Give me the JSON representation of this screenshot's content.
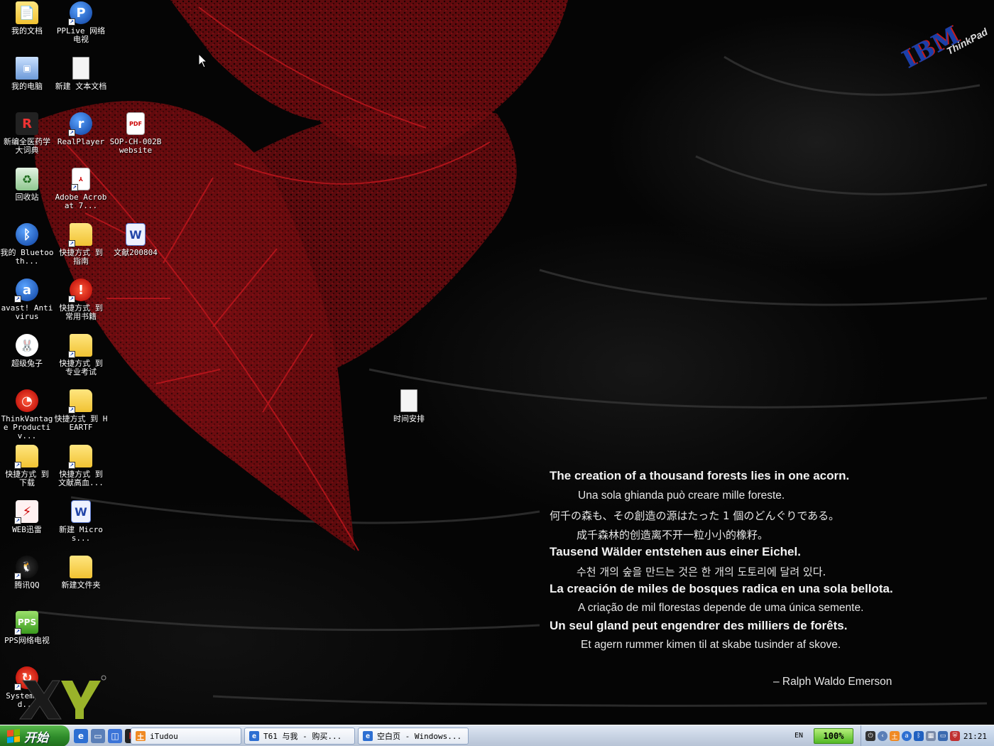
{
  "desktop": {
    "icons": [
      {
        "label": "我的文档",
        "icon": "my-documents-icon",
        "shortcut": false
      },
      {
        "label": "PPLive 网络电视",
        "icon": "pplive-icon",
        "shortcut": true
      },
      {
        "label": "我的电脑",
        "icon": "my-computer-icon",
        "shortcut": false
      },
      {
        "label": "新建 文本文档",
        "icon": "text-document-icon",
        "shortcut": false
      },
      {
        "label": "新编全医药学大词典",
        "icon": "dictionary-app-icon",
        "shortcut": false
      },
      {
        "label": "RealPlayer",
        "icon": "realplayer-icon",
        "shortcut": true
      },
      {
        "label": "SOP-CH-002B website",
        "icon": "pdf-file-icon",
        "shortcut": false
      },
      {
        "label": "回收站",
        "icon": "recycle-bin-icon",
        "shortcut": false
      },
      {
        "label": "Adobe Acrobat 7...",
        "icon": "adobe-acrobat-icon",
        "shortcut": true
      },
      {
        "label": "我的 Bluetooth...",
        "icon": "bluetooth-icon",
        "shortcut": false
      },
      {
        "label": "快捷方式 到 指南",
        "icon": "folder-icon",
        "shortcut": true
      },
      {
        "label": "文献200804",
        "icon": "word-document-icon",
        "shortcut": false
      },
      {
        "label": "avast! Antivirus",
        "icon": "avast-icon",
        "shortcut": true
      },
      {
        "label": "快捷方式 到 常用书籍",
        "icon": "book-app-icon",
        "shortcut": true
      },
      {
        "label": "超级兔子",
        "icon": "rabbit-app-icon",
        "shortcut": false
      },
      {
        "label": "快捷方式 到 专业考试",
        "icon": "folder-icon",
        "shortcut": true
      },
      {
        "label": "ThinkVantage Productiv...",
        "icon": "thinkvantage-icon",
        "shortcut": false
      },
      {
        "label": "快捷方式 到 HEARTF",
        "icon": "folder-icon",
        "shortcut": true
      },
      {
        "label": "时间安排",
        "icon": "text-document-icon",
        "shortcut": false
      },
      {
        "label": "快捷方式 到 下载",
        "icon": "folder-icon",
        "shortcut": true
      },
      {
        "label": "快捷方式 到 文献高血...",
        "icon": "folder-icon",
        "shortcut": true
      },
      {
        "label": "WEB迅雷",
        "icon": "web-thunder-icon",
        "shortcut": true
      },
      {
        "label": "新建 Micros...",
        "icon": "word-document-icon",
        "shortcut": false
      },
      {
        "label": "腾讯QQ",
        "icon": "qq-penguin-icon",
        "shortcut": true
      },
      {
        "label": "新建文件夹",
        "icon": "folder-icon",
        "shortcut": false
      },
      {
        "label": "PPS网络电视",
        "icon": "pps-icon",
        "shortcut": true
      },
      {
        "label": "System Upd...",
        "icon": "system-update-icon",
        "shortcut": true
      }
    ]
  },
  "wallpaper": {
    "brand": "IBM",
    "sub_brand": "ThinkPad",
    "quote_lines": [
      "The creation of a thousand forests lies in one acorn.",
      "Una sola ghianda può creare mille foreste.",
      "何千の森も、その創造の源はたった 1 個のどんぐりである。",
      "成千森林的创造离不开一粒小小的橡籽。",
      "Tausend Wälder entstehen aus einer Eichel.",
      "수천 개의 숲을 만드는 것은 한 개의 도토리에 달려 있다.",
      "La creación de miles de bosques radica en una sola bellota.",
      "A criação de mil florestas depende de uma única semente.",
      "Un seul gland peut engendrer des milliers de forêts.",
      "Et agern rummer kimen til at skabe tusinder af skove."
    ],
    "attribution": "– Ralph Waldo Emerson"
  },
  "taskbar": {
    "start_label": "开始",
    "tasks": [
      {
        "label": "iTudou",
        "icon": "itudou-icon"
      },
      {
        "label": "T61 与我 - 购买...",
        "icon": "internet-explorer-icon"
      },
      {
        "label": "空白页 - Windows...",
        "icon": "internet-explorer-icon"
      }
    ],
    "language": "EN",
    "battery": "100%",
    "clock": "21:21"
  },
  "colors": {
    "leaf": "#8b0f12",
    "taskbar": "#c9d4e4",
    "start": "#2e8b2a"
  }
}
